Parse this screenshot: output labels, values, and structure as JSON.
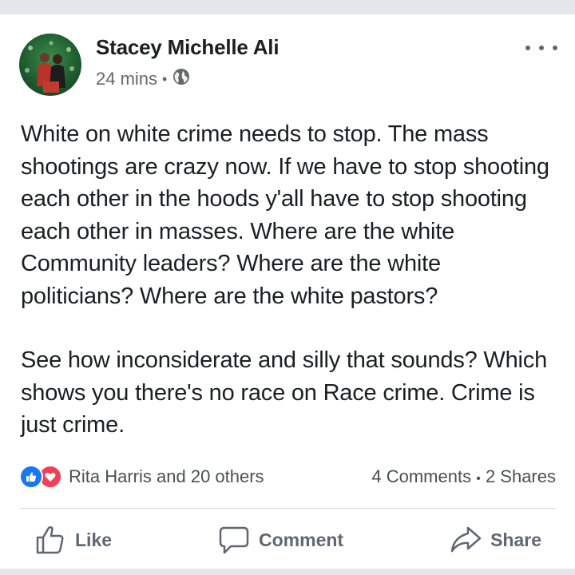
{
  "post": {
    "author": "Stacey Michelle Ali",
    "time": "24 mins",
    "separator": "•",
    "privacy_icon": "globe-icon",
    "paragraphs": [
      "White on white crime needs to stop. The mass shootings are crazy now. If we have to stop shooting each other in the hoods y'all have to stop shooting each other in masses. Where are the white Community leaders? Where are the white politicians? Where are the white pastors?",
      "See how inconsiderate and silly that sounds? Which shows you there's no race on Race crime. Crime is just crime."
    ]
  },
  "stats": {
    "reactions_text": "Rita Harris and 20 others",
    "comments": "4 Comments",
    "separator": "•",
    "shares": "2 Shares",
    "like_color": "#1877f2",
    "love_color": "#f33e58"
  },
  "actions": {
    "like": "Like",
    "comment": "Comment",
    "share": "Share"
  }
}
